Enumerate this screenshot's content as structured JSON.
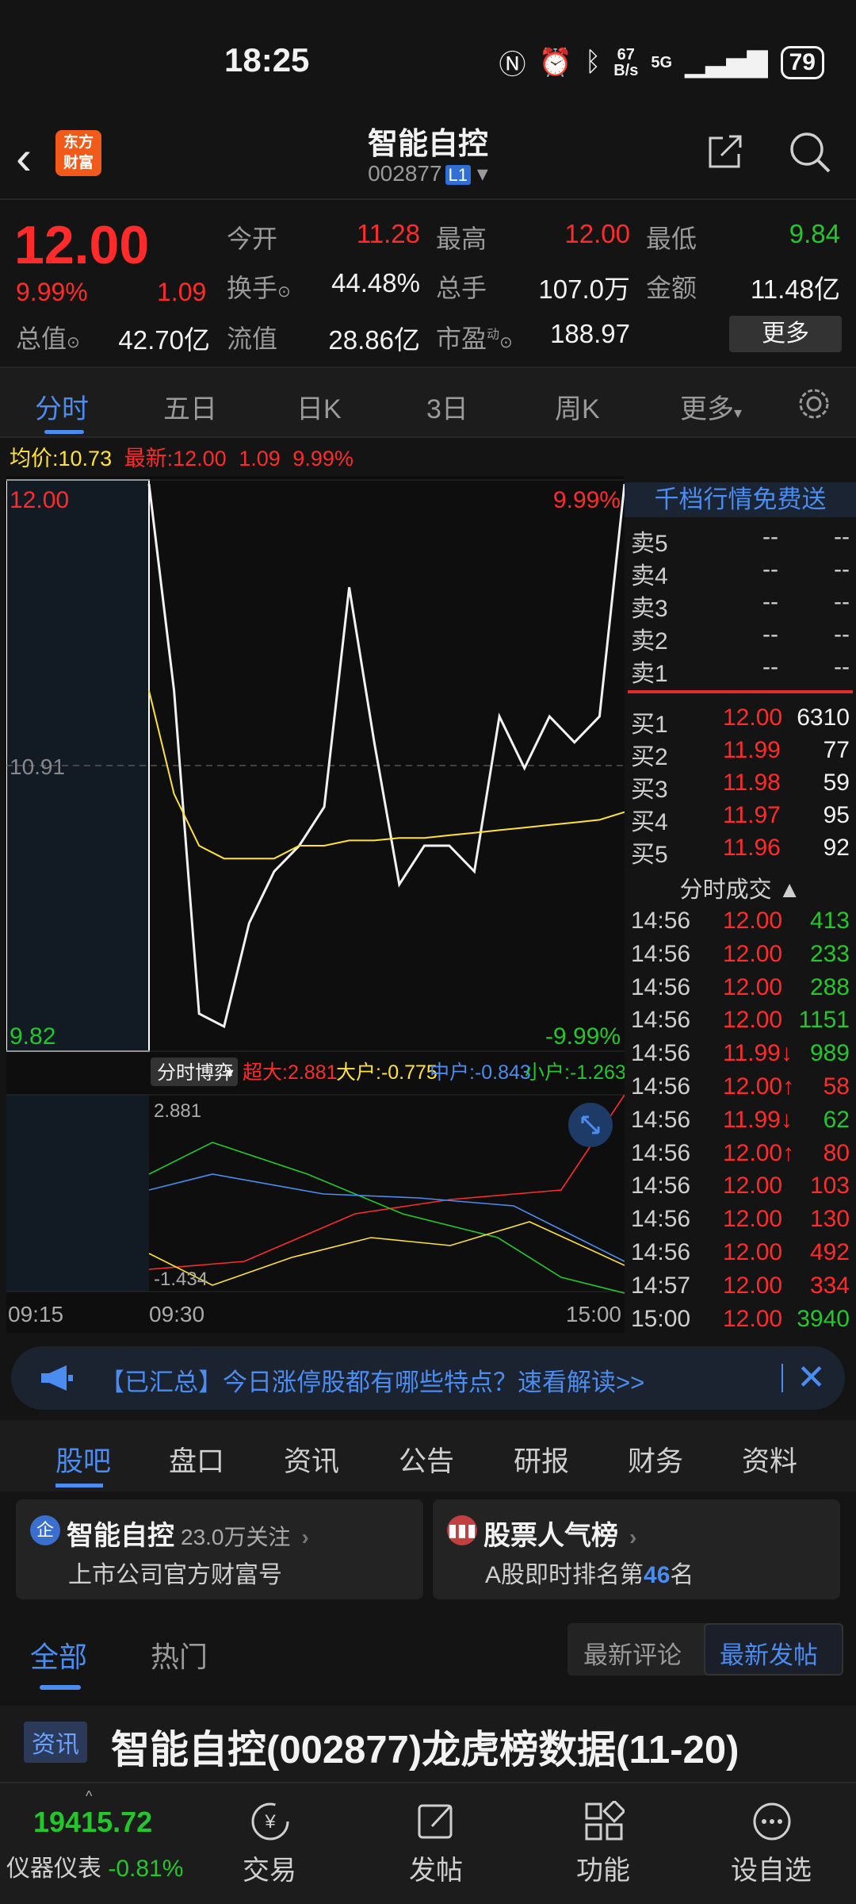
{
  "status": {
    "time": "18:25",
    "net_speed_top": "67",
    "net_speed_bottom": "B/s",
    "signal": "5G",
    "battery": "79"
  },
  "header": {
    "back_label": "<",
    "logo_text_1": "东方",
    "logo_text_2": "财富",
    "title": "智能自控",
    "code": "002877",
    "badge": "L1"
  },
  "quote": {
    "price": "12.00",
    "pct": "9.99%",
    "change": "1.09",
    "labels": {
      "open": "今开",
      "high": "最高",
      "low": "最低",
      "turnover": "换手",
      "volume": "总手",
      "amount": "金额",
      "mktcap": "总值",
      "float": "流值",
      "pe": "市盈",
      "pe_sup": "动"
    },
    "values": {
      "open": "11.28",
      "high": "12.00",
      "low": "9.84",
      "turnover": "44.48%",
      "volume": "107.0万",
      "amount": "11.48亿",
      "mktcap": "42.70亿",
      "float": "28.86亿",
      "pe": "188.97"
    },
    "more": "更多"
  },
  "ktabs": [
    "分时",
    "五日",
    "日K",
    "3日",
    "周K",
    "更多"
  ],
  "infoline": {
    "avg_label": "均价:",
    "avg": "10.73",
    "latest_label": "最新:",
    "latest": "12.00",
    "chg": "1.09",
    "pct": "9.99%"
  },
  "chart": {
    "price_top": "12.00",
    "price_mid": "10.91",
    "price_bottom": "9.82",
    "pct_top": "9.99%",
    "pct_bottom": "-9.99%",
    "flow_button": "分时博弈",
    "flow_legend": [
      {
        "label": "超大:2.881",
        "color": "#ff2b2b"
      },
      {
        "label": "大户:-0.775",
        "color": "#ffe233"
      },
      {
        "label": "中户:-0.843",
        "color": "#4a8cf0"
      },
      {
        "label": "小户:-1.263",
        "color": "#23c72c"
      }
    ],
    "flow_top": "2.881",
    "flow_bottom": "-1.434",
    "time_start": "09:15",
    "time_open": "09:30",
    "time_end": "15:00"
  },
  "chart_data": {
    "type": "line",
    "title": "",
    "series": [
      {
        "values": [
          12.0,
          11.2,
          9.95,
          9.9,
          10.3,
          10.5,
          10.6,
          10.75,
          11.6,
          11.0,
          10.45,
          10.6,
          10.6,
          10.5,
          11.1,
          10.9,
          11.1,
          11.0,
          11.1,
          12.0
        ]
      },
      {
        "values": [
          11.2,
          10.8,
          10.6,
          10.55,
          10.55,
          10.55,
          10.6,
          10.6,
          10.62,
          10.62,
          10.63,
          10.63,
          10.64,
          10.65,
          10.66,
          10.67,
          10.68,
          10.69,
          10.7,
          10.73
        ]
      }
    ],
    "ylim": [
      9.82,
      12.0
    ]
  },
  "orderbook": {
    "promo": "千档行情免费送",
    "sell": [
      {
        "label": "卖5",
        "price": "--",
        "vol": "--"
      },
      {
        "label": "卖4",
        "price": "--",
        "vol": "--"
      },
      {
        "label": "卖3",
        "price": "--",
        "vol": "--"
      },
      {
        "label": "卖2",
        "price": "--",
        "vol": "--"
      },
      {
        "label": "卖1",
        "price": "--",
        "vol": "--"
      }
    ],
    "buy": [
      {
        "label": "买1",
        "price": "12.00",
        "vol": "6310"
      },
      {
        "label": "买2",
        "price": "11.99",
        "vol": "77"
      },
      {
        "label": "买3",
        "price": "11.98",
        "vol": "59"
      },
      {
        "label": "买4",
        "price": "11.97",
        "vol": "95"
      },
      {
        "label": "买5",
        "price": "11.96",
        "vol": "92"
      }
    ],
    "ticks_title": "分时成交",
    "ticks": [
      {
        "time": "14:56",
        "price": "12.00",
        "vol": "413",
        "vc": "green"
      },
      {
        "time": "14:56",
        "price": "12.00",
        "vol": "233",
        "vc": "green"
      },
      {
        "time": "14:56",
        "price": "12.00",
        "vol": "288",
        "vc": "green"
      },
      {
        "time": "14:56",
        "price": "12.00",
        "vol": "1151",
        "vc": "green"
      },
      {
        "time": "14:56",
        "price": "11.99↓",
        "vol": "989",
        "vc": "green"
      },
      {
        "time": "14:56",
        "price": "12.00↑",
        "vol": "58",
        "vc": "red"
      },
      {
        "time": "14:56",
        "price": "11.99↓",
        "vol": "62",
        "vc": "green"
      },
      {
        "time": "14:56",
        "price": "12.00↑",
        "vol": "80",
        "vc": "red"
      },
      {
        "time": "14:56",
        "price": "12.00",
        "vol": "103",
        "vc": "red"
      },
      {
        "time": "14:56",
        "price": "12.00",
        "vol": "130",
        "vc": "red"
      },
      {
        "time": "14:56",
        "price": "12.00",
        "vol": "492",
        "vc": "red"
      },
      {
        "time": "14:57",
        "price": "12.00",
        "vol": "334",
        "vc": "red"
      },
      {
        "time": "15:00",
        "price": "12.00",
        "vol": "3940",
        "vc": "green"
      }
    ]
  },
  "banner": {
    "text": "【已汇总】今日涨停股都有哪些特点？速看解读>>"
  },
  "btabs": [
    "股吧",
    "盘口",
    "资讯",
    "公告",
    "研报",
    "财务",
    "资料"
  ],
  "cards": [
    {
      "badge": "企",
      "title": "智能自控",
      "extra": "23.0万关注",
      "sub": "上市公司官方财富号"
    },
    {
      "badge": "",
      "title": "股票人气榜",
      "sub_pre": "A股即时排名第",
      "rank": "46",
      "sub_post": "名"
    }
  ],
  "filter": {
    "all": "全部",
    "hot": "热门",
    "latest_comment": "最新评论",
    "latest_post": "最新发帖"
  },
  "news": {
    "tag": "资讯",
    "headline": "智能自控(002877)龙虎榜数据(11-20)"
  },
  "bnav": {
    "index_value": "19415.72",
    "index_name": "仪器仪表",
    "index_pct": "-0.81%",
    "items": [
      "交易",
      "发帖",
      "功能",
      "设自选"
    ]
  }
}
